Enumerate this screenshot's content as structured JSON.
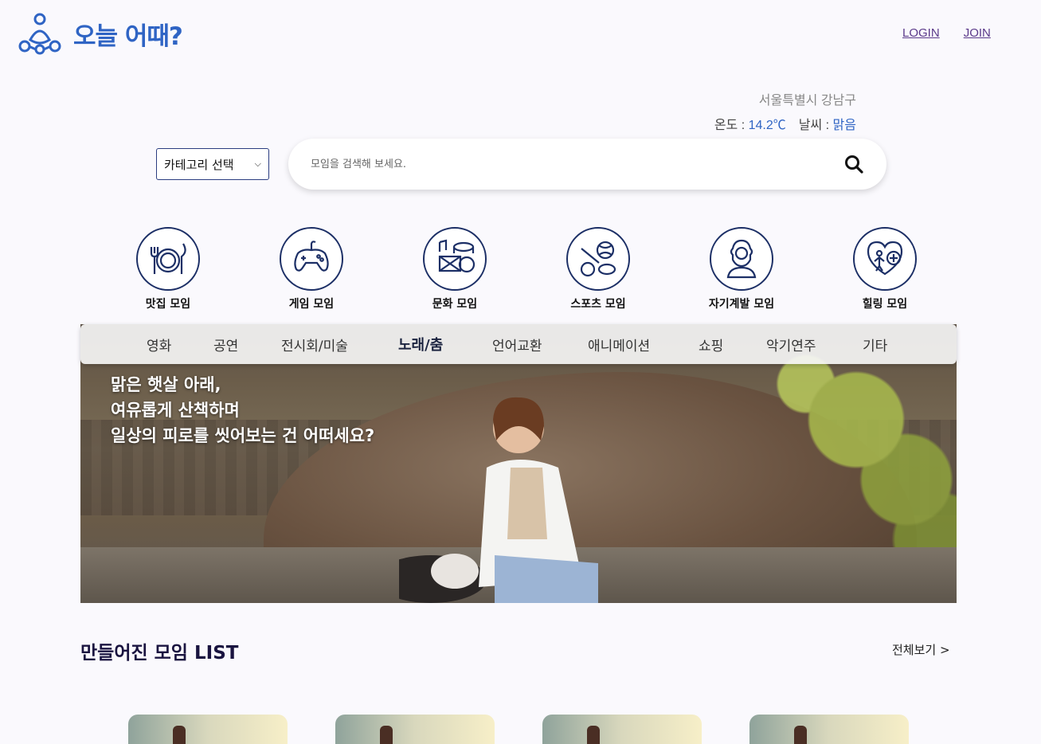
{
  "header": {
    "logo_text": "오늘 어때?",
    "login_label": "LOGIN",
    "join_label": "JOIN"
  },
  "weather": {
    "location": "서울특별시 강남구",
    "temp_label": "온도 : ",
    "temp_value": "14.2℃",
    "weather_label": "날씨 : ",
    "weather_value": "맑음"
  },
  "search": {
    "category_select": "카테고리 선택",
    "placeholder": "모임을 검색해 보세요."
  },
  "categories": [
    {
      "label": "맛집 모임",
      "icon": "dining-icon"
    },
    {
      "label": "게임 모임",
      "icon": "gamepad-icon"
    },
    {
      "label": "문화 모임",
      "icon": "culture-icon"
    },
    {
      "label": "스포츠 모임",
      "icon": "sports-icon"
    },
    {
      "label": "자기계발 모임",
      "icon": "self-development-icon"
    },
    {
      "label": "힐링 모임",
      "icon": "healing-icon"
    }
  ],
  "subnav": {
    "items": [
      "영화",
      "공연",
      "전시회/미술",
      "노래/춤",
      "언어교환",
      "애니메이션",
      "쇼핑",
      "악기연주",
      "기타"
    ],
    "active_index": 3
  },
  "hero": {
    "line1": "맑은 햇살 아래,",
    "line2": "여유롭게 산책하며",
    "line3": "일상의 피로를 씻어보는 건 어떠세요?"
  },
  "list_section": {
    "title": "만들어진 모임 LIST",
    "view_all": "전체보기  >"
  },
  "colors": {
    "brand": "#2f64c4",
    "navy": "#1c2f66",
    "link": "#5b3a8a"
  }
}
